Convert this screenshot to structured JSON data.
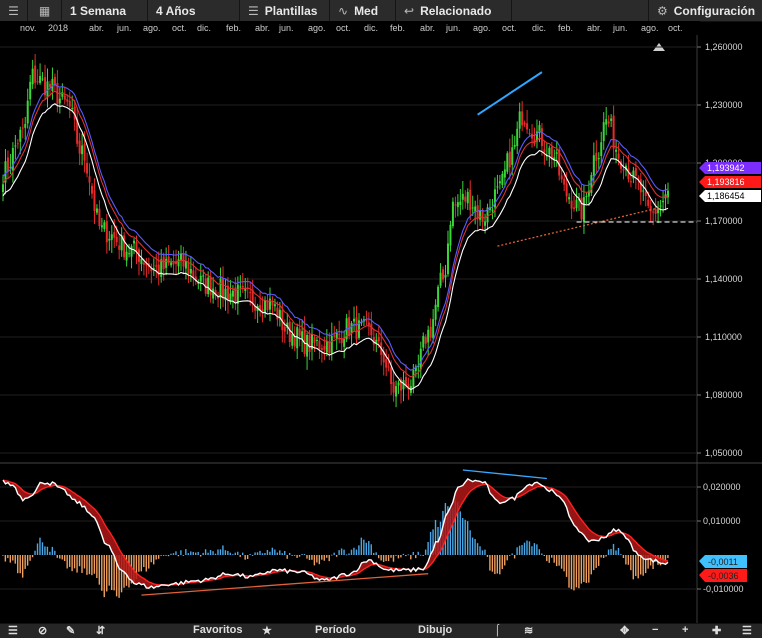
{
  "toolbar": {
    "menu_icon": "menu-icon",
    "layout_icon": "layout-grid-icon",
    "interval": "1 Semana",
    "range": "4 Años",
    "templates": "Plantillas",
    "templates_icon": "sliders-icon",
    "med": "Med",
    "med_icon": "pulse-wave-icon",
    "related": "Relacionado",
    "related_icon": "back-arrow-icon",
    "settings": "Configuración",
    "settings_icon": "gear-icon"
  },
  "bottombar": {
    "favorites": "Favoritos",
    "period": "Período",
    "drawing": "Dibujo"
  },
  "chart_data": {
    "type": "candlestick",
    "x_ticks": [
      "nov.",
      "2018",
      "abr.",
      "jun.",
      "ago.",
      "oct.",
      "dic.",
      "feb.",
      "abr.",
      "jun.",
      "ago.",
      "oct.",
      "dic.",
      "feb.",
      "abr.",
      "jun.",
      "ago.",
      "oct.",
      "dic.",
      "feb.",
      "abr.",
      "jun.",
      "ago.",
      "oct."
    ],
    "price_panel": {
      "y_ticks": [
        "1,260000",
        "1,230000",
        "1,200000",
        "1,170000",
        "1,140000",
        "1,110000",
        "1,080000",
        "1,050000"
      ],
      "ylim": [
        1.05,
        1.26
      ],
      "badges": [
        {
          "label": "1,193816",
          "color": "#ff1a1a"
        },
        {
          "label": "1,186454",
          "color": "#ffffff"
        },
        {
          "label": "1,193942",
          "color": "#7b2cff"
        }
      ],
      "candles_weekly_close_anchors": [
        [
          0,
          1.195
        ],
        [
          8,
          1.215
        ],
        [
          12,
          1.245
        ],
        [
          18,
          1.24
        ],
        [
          26,
          1.23
        ],
        [
          32,
          1.205
        ],
        [
          40,
          1.165
        ],
        [
          52,
          1.155
        ],
        [
          62,
          1.145
        ],
        [
          72,
          1.148
        ],
        [
          82,
          1.137
        ],
        [
          92,
          1.133
        ],
        [
          100,
          1.13
        ],
        [
          108,
          1.127
        ],
        [
          116,
          1.112
        ],
        [
          124,
          1.106
        ],
        [
          132,
          1.107
        ],
        [
          140,
          1.115
        ],
        [
          148,
          1.113
        ],
        [
          153,
          1.102
        ],
        [
          158,
          1.083
        ],
        [
          166,
          1.087
        ],
        [
          172,
          1.112
        ],
        [
          178,
          1.14
        ],
        [
          182,
          1.178
        ],
        [
          188,
          1.182
        ],
        [
          194,
          1.172
        ],
        [
          200,
          1.184
        ],
        [
          206,
          1.205
        ],
        [
          210,
          1.225
        ],
        [
          216,
          1.215
        ],
        [
          222,
          1.205
        ],
        [
          228,
          1.184
        ],
        [
          234,
          1.175
        ],
        [
          240,
          1.205
        ],
        [
          244,
          1.222
        ],
        [
          250,
          1.203
        ],
        [
          256,
          1.19
        ],
        [
          262,
          1.173
        ],
        [
          266,
          1.178
        ],
        [
          268,
          1.183
        ]
      ],
      "trendlines": [
        {
          "name": "upper",
          "color": "#2fa6ff",
          "from": [
            192,
            1.225
          ],
          "to": [
            218,
            1.247
          ]
        },
        {
          "name": "lower-dotted",
          "color": "#e0603a",
          "from": [
            200,
            1.157
          ],
          "to": [
            266,
            1.177
          ]
        },
        {
          "name": "horizontal",
          "color": "#ffffff",
          "value": 1.1695
        }
      ],
      "moving_averages": [
        "white",
        "#e03030",
        "#5a5aff"
      ]
    },
    "macd_panel": {
      "y_ticks": [
        "0,020000",
        "0,010000",
        "-0,010000"
      ],
      "ylim": [
        -0.0122,
        0.0255
      ],
      "badges": [
        {
          "label": "-0,0011",
          "color": "#3fc0ff"
        },
        {
          "label": "-0,0036",
          "color": "#ff1a1a"
        }
      ],
      "macd_anchors": [
        [
          0,
          0.0215
        ],
        [
          4,
          0.0205
        ],
        [
          8,
          0.0165
        ],
        [
          12,
          0.018
        ],
        [
          16,
          0.0215
        ],
        [
          20,
          0.021
        ],
        [
          24,
          0.019
        ],
        [
          30,
          0.0155
        ],
        [
          36,
          0.012
        ],
        [
          42,
          0.003
        ],
        [
          48,
          -0.0045
        ],
        [
          54,
          -0.0085
        ],
        [
          60,
          -0.0095
        ],
        [
          68,
          -0.0085
        ],
        [
          80,
          -0.0075
        ],
        [
          92,
          -0.0055
        ],
        [
          100,
          -0.0065
        ],
        [
          110,
          -0.0045
        ],
        [
          120,
          -0.005
        ],
        [
          130,
          -0.0075
        ],
        [
          140,
          -0.0055
        ],
        [
          148,
          -0.0015
        ],
        [
          156,
          -0.0045
        ],
        [
          164,
          -0.0045
        ],
        [
          170,
          -0.004
        ],
        [
          176,
          0.004
        ],
        [
          180,
          0.0125
        ],
        [
          184,
          0.0195
        ],
        [
          188,
          0.022
        ],
        [
          194,
          0.0215
        ],
        [
          200,
          0.0155
        ],
        [
          206,
          0.0165
        ],
        [
          212,
          0.0205
        ],
        [
          216,
          0.0215
        ],
        [
          220,
          0.0195
        ],
        [
          226,
          0.0165
        ],
        [
          232,
          0.0075
        ],
        [
          238,
          0.004
        ],
        [
          244,
          0.0055
        ],
        [
          248,
          0.0075
        ],
        [
          252,
          0.0055
        ],
        [
          256,
          0.0005
        ],
        [
          262,
          -0.0015
        ],
        [
          268,
          -0.0025
        ]
      ],
      "trendlines": [
        {
          "name": "upper-blue",
          "color": "#3aa8ff",
          "from": [
            186,
            0.025
          ],
          "to": [
            220,
            0.0225
          ]
        },
        {
          "name": "lower-orange",
          "color": "#e0603a",
          "from": [
            56,
            -0.0118
          ],
          "to": [
            172,
            -0.0055
          ]
        }
      ]
    }
  }
}
